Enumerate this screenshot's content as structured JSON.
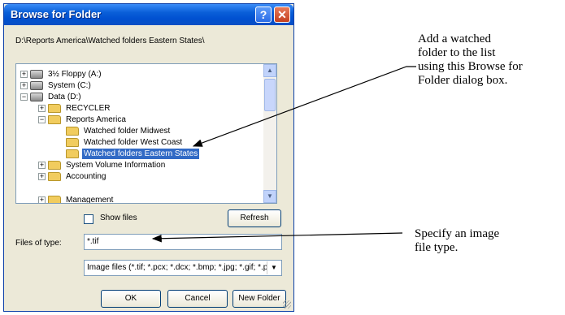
{
  "dialog": {
    "title": "Browse for Folder",
    "help_glyph": "?",
    "close_glyph": "✕",
    "current_path": "D:\\Reports America\\Watched folders Eastern States\\",
    "tree": [
      {
        "label": "3½ Floppy (A:)",
        "icon": "floppy-drive-icon",
        "expander": "+"
      },
      {
        "label": "System (C:)",
        "icon": "hard-drive-icon",
        "expander": "+"
      },
      {
        "label": "Data (D:)",
        "icon": "hard-drive-icon",
        "expander": "−"
      },
      {
        "label": "RECYCLER",
        "icon": "folder-icon",
        "expander": "+"
      },
      {
        "label": "Reports America",
        "icon": "folder-icon",
        "expander": "−"
      },
      {
        "label": "Watched folder Midwest",
        "icon": "folder-icon",
        "expander": ""
      },
      {
        "label": "Watched folder West Coast",
        "icon": "folder-icon",
        "expander": ""
      },
      {
        "label": "Watched folders Eastern States",
        "icon": "open-folder-icon",
        "expander": "",
        "selected": true
      },
      {
        "label": "System Volume Information",
        "icon": "folder-icon",
        "expander": "+"
      },
      {
        "label": "Accounting",
        "icon": "folder-icon",
        "expander": "+"
      },
      {
        "label": "Management",
        "icon": "folder-icon",
        "expander": "+"
      }
    ],
    "show_files_label": "Show files",
    "show_files_checked": false,
    "refresh_label": "Refresh",
    "files_of_type_label": "Files of type:",
    "files_of_type_value": "*.tif",
    "image_type_selected": "Image files (*.tif; *.pcx; *.dcx; *.bmp; *.jpg; *.gif; *.p",
    "ok_label": "OK",
    "cancel_label": "Cancel",
    "new_folder_label": "New Folder"
  },
  "annotations": {
    "watched_folder": [
      "Add a watched",
      "folder to the list",
      "using this Browse for",
      "Folder dialog box."
    ],
    "file_type": [
      "Specify an image",
      "file type."
    ]
  }
}
